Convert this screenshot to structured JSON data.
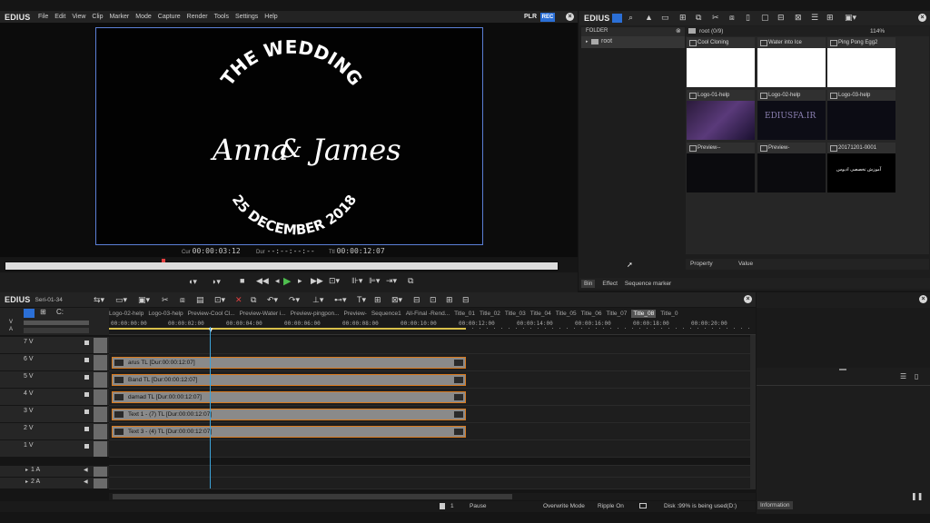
{
  "player": {
    "app_name": "EDIUS",
    "menu": [
      "File",
      "Edit",
      "View",
      "Clip",
      "Marker",
      "Mode",
      "Capture",
      "Render",
      "Tools",
      "Settings",
      "Help"
    ],
    "plr_label": "PLR",
    "rec_label": "REC",
    "overlay": {
      "line1": "THE WEDDING",
      "names_a": "Anna",
      "names_amp": "&",
      "names_b": "James",
      "date": "25 DECEMBER 2018"
    },
    "cur_label": "Cur",
    "cur_value": "00:00:03:12",
    "dur_label": "Dur",
    "dur_value": "--:--:--:--",
    "ttl_label": "Ttl",
    "ttl_value": "00:00:12:07"
  },
  "bin": {
    "app_name": "EDIUS",
    "folder_header": "FOLDER",
    "root_folder": "root",
    "breadcrumb": "root (0/9)",
    "zoom": "114%",
    "clips": [
      {
        "name": "Cool Cloning",
        "thumb": "white"
      },
      {
        "name": "Water into Ice",
        "thumb": "white"
      },
      {
        "name": "Ping Pong Egg2",
        "thumb": "white"
      },
      {
        "name": "Logo-01-help",
        "thumb": "logo"
      },
      {
        "name": "Logo-02-help",
        "thumb": "logo2"
      },
      {
        "name": "Logo-03-help",
        "thumb": "dark"
      },
      {
        "name": "Preview--",
        "thumb": "dark"
      },
      {
        "name": "Preview-",
        "thumb": "dark"
      },
      {
        "name": "20171201-0001",
        "thumb": "text"
      }
    ],
    "logo_thumb_text": "EDIUSFA.IR",
    "text_thumb_caption": "آموزش تخصصی ادیوس",
    "property_col": "Property",
    "value_col": "Value",
    "tabs": [
      "Bin",
      "Effect",
      "Sequence marker"
    ]
  },
  "timeline": {
    "app_name": "EDIUS",
    "project_name": "Seri-01-34",
    "sequence_tabs": [
      "Logo-02-help",
      "Logo-03-help",
      "Preview-Cool Cl...",
      "Preview-Water i...",
      "Preview-pingpon...",
      "Preview-",
      "Sequence1",
      "All-Final -Rend...",
      "Title_01",
      "Title_02",
      "Title_03",
      "Title_04",
      "Title_05",
      "Title_06",
      "Title_07",
      "Title_08",
      "Title_0"
    ],
    "active_tab": "Title_08",
    "ruler": [
      "00:00:00:00",
      "00:00:02:00",
      "00:00:04:00",
      "00:00:06:00",
      "00:00:08:00",
      "00:00:10:00",
      "00:00:12:00",
      "00:00:14:00",
      "00:00:16:00",
      "00:00:18:00",
      "00:00:20:00"
    ],
    "tracks": [
      {
        "name": "V",
        "clip": ""
      },
      {
        "name": "",
        "clip": ""
      },
      {
        "name": "7 V",
        "clip": ""
      },
      {
        "name": "6 V",
        "clip": "arus  TL [Dur:00:00:12:07]"
      },
      {
        "name": "5 V",
        "clip": "Band  TL [Dur:00:00:12:07]"
      },
      {
        "name": "4 V",
        "clip": "damad  TL [Dur:00:00:12:07]"
      },
      {
        "name": "3 V",
        "clip": "Text 1 - (7)  TL [Dur:00:00:12:07]"
      },
      {
        "name": "2 V",
        "clip": "Text 3 - (4)  TL [Dur:00:00:12:07]"
      },
      {
        "name": "1 V",
        "clip": ""
      },
      {
        "name": "1 A",
        "clip": ""
      },
      {
        "name": "2 A",
        "clip": ""
      }
    ],
    "a_label": "A"
  },
  "status": {
    "count": "1",
    "state": "Pause",
    "mode": "Overwrite Mode",
    "ripple": "Ripple On",
    "disk": "Disk :99% is being used(D:)"
  },
  "info_tab": "Information",
  "colors": {
    "accent": "#2b6fd6",
    "clip_border": "#d87a1e",
    "playhead": "#3da3d8"
  }
}
